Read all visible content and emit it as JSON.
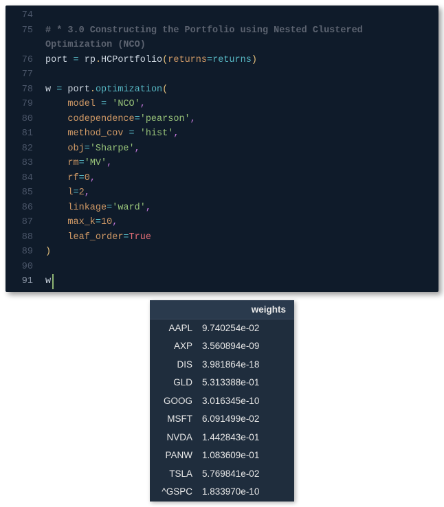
{
  "editor": {
    "lines": [
      {
        "num": "74",
        "tokens": []
      },
      {
        "num": "75",
        "tokens": [
          {
            "cls": "c-comment",
            "text": "# * 3.0 Constructing the Portfolio using Nested Clustered"
          }
        ]
      },
      {
        "num": "",
        "tokens": [
          {
            "cls": "c-comment",
            "text": "Optimization (NCO)"
          }
        ]
      },
      {
        "num": "76",
        "tokens": [
          {
            "cls": "c-default",
            "text": "port "
          },
          {
            "cls": "c-op",
            "text": "="
          },
          {
            "cls": "c-default",
            "text": " rp"
          },
          {
            "cls": "c-punc",
            "text": "."
          },
          {
            "cls": "c-default",
            "text": "HCPortfolio"
          },
          {
            "cls": "c-paren",
            "text": "("
          },
          {
            "cls": "c-param",
            "text": "returns"
          },
          {
            "cls": "c-op",
            "text": "="
          },
          {
            "cls": "c-func",
            "text": "returns"
          },
          {
            "cls": "c-paren",
            "text": ")"
          }
        ]
      },
      {
        "num": "77",
        "tokens": []
      },
      {
        "num": "78",
        "tokens": [
          {
            "cls": "c-default",
            "text": "w "
          },
          {
            "cls": "c-op",
            "text": "="
          },
          {
            "cls": "c-default",
            "text": " port"
          },
          {
            "cls": "c-punc",
            "text": "."
          },
          {
            "cls": "c-func",
            "text": "optimization"
          },
          {
            "cls": "c-paren",
            "text": "("
          }
        ]
      },
      {
        "num": "79",
        "tokens": [
          {
            "cls": "c-default",
            "text": "    "
          },
          {
            "cls": "c-param",
            "text": "model"
          },
          {
            "cls": "c-default",
            "text": " "
          },
          {
            "cls": "c-op",
            "text": "="
          },
          {
            "cls": "c-default",
            "text": " "
          },
          {
            "cls": "c-string",
            "text": "'NCO'"
          },
          {
            "cls": "c-punc2",
            "text": ","
          }
        ]
      },
      {
        "num": "80",
        "tokens": [
          {
            "cls": "c-default",
            "text": "    "
          },
          {
            "cls": "c-param",
            "text": "codependence"
          },
          {
            "cls": "c-op",
            "text": "="
          },
          {
            "cls": "c-string",
            "text": "'pearson'"
          },
          {
            "cls": "c-punc2",
            "text": ","
          }
        ]
      },
      {
        "num": "81",
        "tokens": [
          {
            "cls": "c-default",
            "text": "    "
          },
          {
            "cls": "c-param",
            "text": "method_cov"
          },
          {
            "cls": "c-default",
            "text": " "
          },
          {
            "cls": "c-op",
            "text": "="
          },
          {
            "cls": "c-default",
            "text": " "
          },
          {
            "cls": "c-string",
            "text": "'hist'"
          },
          {
            "cls": "c-punc2",
            "text": ","
          }
        ]
      },
      {
        "num": "82",
        "tokens": [
          {
            "cls": "c-default",
            "text": "    "
          },
          {
            "cls": "c-param",
            "text": "obj"
          },
          {
            "cls": "c-op",
            "text": "="
          },
          {
            "cls": "c-string",
            "text": "'Sharpe'"
          },
          {
            "cls": "c-punc2",
            "text": ","
          }
        ]
      },
      {
        "num": "83",
        "tokens": [
          {
            "cls": "c-default",
            "text": "    "
          },
          {
            "cls": "c-param",
            "text": "rm"
          },
          {
            "cls": "c-op",
            "text": "="
          },
          {
            "cls": "c-string",
            "text": "'MV'"
          },
          {
            "cls": "c-punc2",
            "text": ","
          }
        ]
      },
      {
        "num": "84",
        "tokens": [
          {
            "cls": "c-default",
            "text": "    "
          },
          {
            "cls": "c-param",
            "text": "rf"
          },
          {
            "cls": "c-op",
            "text": "="
          },
          {
            "cls": "c-number",
            "text": "0"
          },
          {
            "cls": "c-punc2",
            "text": ","
          }
        ]
      },
      {
        "num": "85",
        "tokens": [
          {
            "cls": "c-default",
            "text": "    "
          },
          {
            "cls": "c-param",
            "text": "l"
          },
          {
            "cls": "c-op",
            "text": "="
          },
          {
            "cls": "c-number",
            "text": "2"
          },
          {
            "cls": "c-punc2",
            "text": ","
          }
        ]
      },
      {
        "num": "86",
        "tokens": [
          {
            "cls": "c-default",
            "text": "    "
          },
          {
            "cls": "c-param",
            "text": "linkage"
          },
          {
            "cls": "c-op",
            "text": "="
          },
          {
            "cls": "c-string",
            "text": "'ward'"
          },
          {
            "cls": "c-punc2",
            "text": ","
          }
        ]
      },
      {
        "num": "87",
        "tokens": [
          {
            "cls": "c-default",
            "text": "    "
          },
          {
            "cls": "c-param",
            "text": "max_k"
          },
          {
            "cls": "c-op",
            "text": "="
          },
          {
            "cls": "c-number",
            "text": "10"
          },
          {
            "cls": "c-punc2",
            "text": ","
          }
        ]
      },
      {
        "num": "88",
        "tokens": [
          {
            "cls": "c-default",
            "text": "    "
          },
          {
            "cls": "c-param",
            "text": "leaf_order"
          },
          {
            "cls": "c-op",
            "text": "="
          },
          {
            "cls": "c-const",
            "text": "True"
          }
        ]
      },
      {
        "num": "89",
        "tokens": [
          {
            "cls": "c-paren",
            "text": ")"
          }
        ]
      },
      {
        "num": "90",
        "tokens": []
      },
      {
        "num": "91",
        "active": true,
        "tokens": [
          {
            "cls": "c-default",
            "text": "w"
          }
        ]
      }
    ]
  },
  "output": {
    "header": {
      "label": "",
      "value": "weights"
    },
    "rows": [
      {
        "label": "AAPL",
        "value": "9.740254e-02"
      },
      {
        "label": "AXP",
        "value": "3.560894e-09"
      },
      {
        "label": "DIS",
        "value": "3.981864e-18"
      },
      {
        "label": "GLD",
        "value": "5.313388e-01"
      },
      {
        "label": "GOOG",
        "value": "3.016345e-10"
      },
      {
        "label": "MSFT",
        "value": "6.091499e-02"
      },
      {
        "label": "NVDA",
        "value": "1.442843e-01"
      },
      {
        "label": "PANW",
        "value": "1.083609e-01"
      },
      {
        "label": "TSLA",
        "value": "5.769841e-02"
      },
      {
        "label": "^GSPC",
        "value": "1.833970e-10"
      }
    ]
  }
}
